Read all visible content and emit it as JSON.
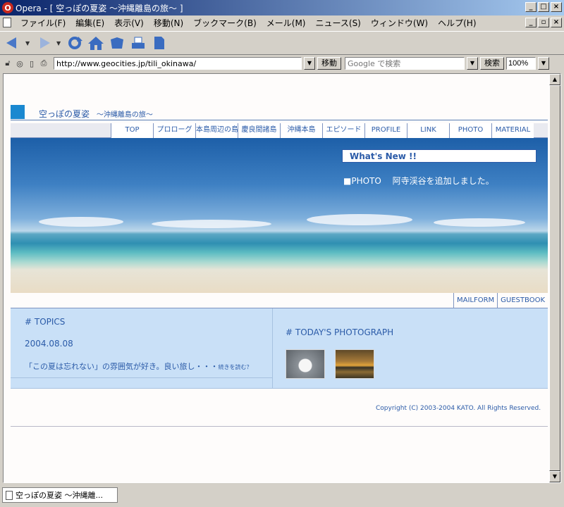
{
  "window": {
    "title": "Opera - [ 空っぽの夏姿 ～沖縄離島の旅～ ]",
    "app_icon": "opera-icon"
  },
  "menubar": {
    "items": [
      {
        "label": "ファイル(F)"
      },
      {
        "label": "編集(E)"
      },
      {
        "label": "表示(V)"
      },
      {
        "label": "移動(N)"
      },
      {
        "label": "ブックマーク(B)"
      },
      {
        "label": "メール(M)"
      },
      {
        "label": "ニュース(S)"
      },
      {
        "label": "ウィンドウ(W)"
      },
      {
        "label": "ヘルプ(H)"
      }
    ]
  },
  "toolbar": {
    "buttons": [
      "back-icon",
      "forward-icon",
      "reload-icon",
      "home-icon",
      "hotlist-icon",
      "print-icon",
      "page-icon"
    ]
  },
  "addressbar": {
    "url": "http://www.geocities.jp/tili_okinawa/",
    "go_label": "移動",
    "search_placeholder": "Google で検索",
    "search_label": "検索",
    "zoom": "100%"
  },
  "site": {
    "title": "空っぽの夏姿",
    "subtitle": "～沖縄離島の旅～",
    "nav": [
      {
        "label": "TOP"
      },
      {
        "label": "プロローグ"
      },
      {
        "label": "本島周辺の島"
      },
      {
        "label": "慶良間諸島"
      },
      {
        "label": "沖縄本島"
      },
      {
        "label": "エピソード"
      },
      {
        "label": "PROFILE"
      },
      {
        "label": "LINK"
      },
      {
        "label": "PHOTO"
      },
      {
        "label": "MATERIAL"
      }
    ],
    "whats_new": {
      "heading": "What's New !!",
      "line": "■PHOTO　 阿寺渓谷を追加しました。"
    },
    "subnav": [
      {
        "label": "MAILFORM"
      },
      {
        "label": "GUESTBOOK"
      }
    ],
    "topics": {
      "heading": "#  TOPICS",
      "date": "2004.08.08",
      "teaser": "「この夏は忘れない」の雰囲気が好き。良い旅し・・・",
      "more": "続きを読む？"
    },
    "photo": {
      "heading": "#  TODAY'S PHOTOGRAPH"
    },
    "copyright": "Copyright (C) 2003-2004 KATO. All Rights Reserved."
  },
  "statusbar": {
    "tab_label": "空っぽの夏姿 ～沖縄離..."
  }
}
